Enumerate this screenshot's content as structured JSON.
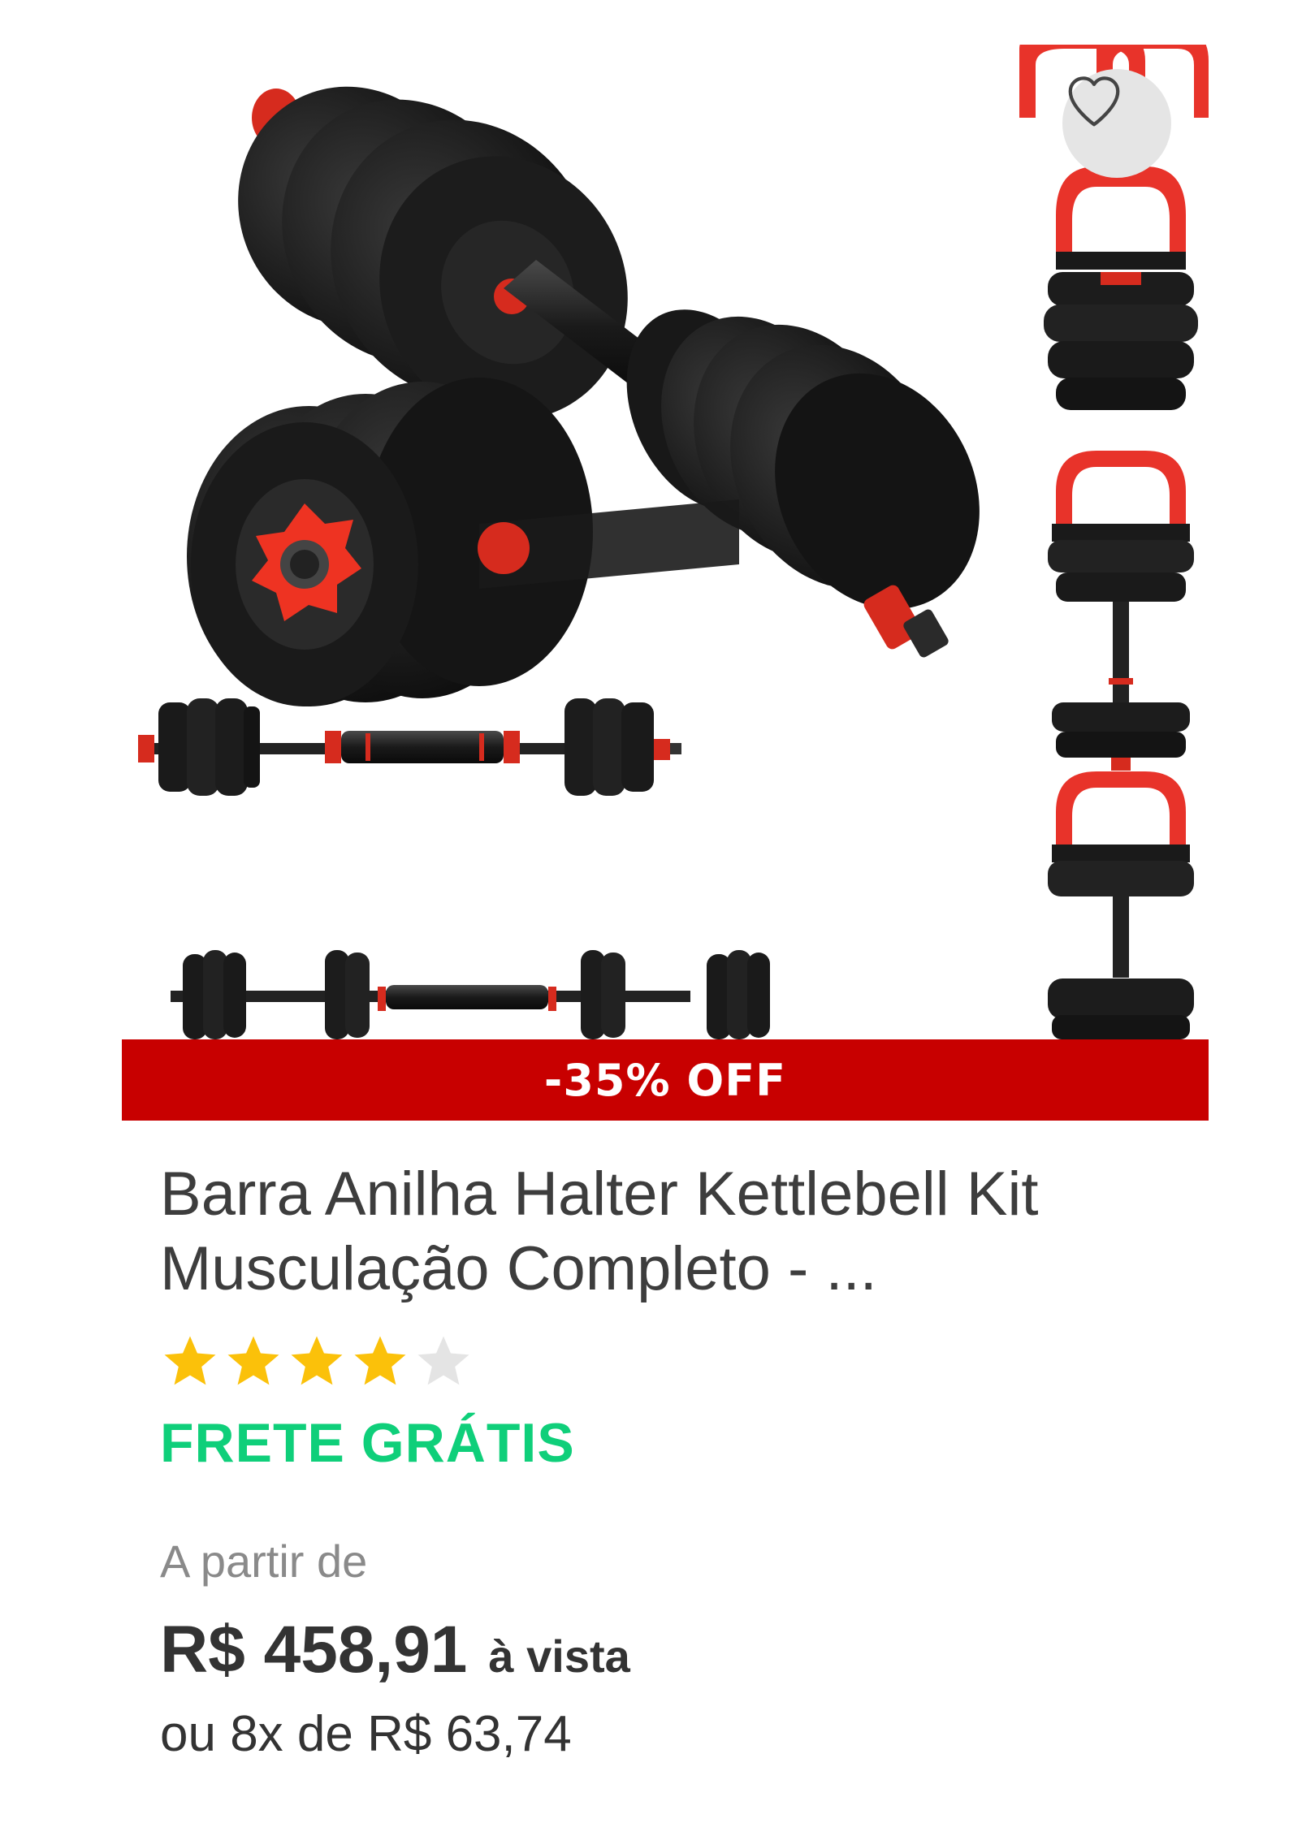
{
  "product": {
    "discount_badge": "-35% OFF",
    "title": "Barra Anilha Halter Kettlebell Kit Musculação Completo - ...",
    "rating": {
      "value": 4,
      "max": 5
    },
    "shipping": "FRETE GRÁTIS",
    "price": {
      "prefix": "A partir de",
      "amount": "R$ 458,91",
      "cash_label": "à vista",
      "installments": "ou 8x de R$ 63,74"
    }
  },
  "icons": {
    "favorite": "heart-outline-icon",
    "star": "star-icon"
  },
  "colors": {
    "discount_banner": "#c80000",
    "shipping": "#0fcf7a",
    "star_filled": "#fbc10a",
    "star_empty": "#e4e4e4"
  }
}
